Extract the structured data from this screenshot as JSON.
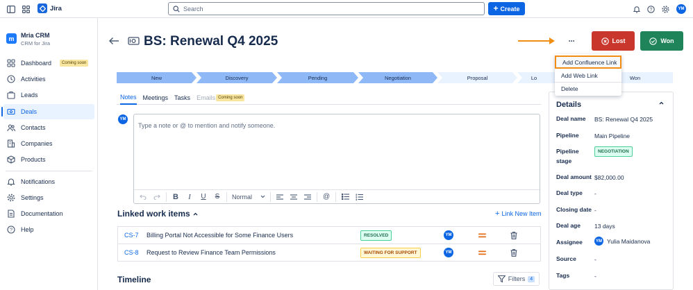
{
  "app": {
    "name": "Jira"
  },
  "search": {
    "placeholder": "Search"
  },
  "header": {
    "create_label": "Create",
    "avatar_initials": "YM"
  },
  "project": {
    "name": "Mria CRM",
    "subtitle": "CRM for Jira"
  },
  "sidebar": {
    "items": [
      {
        "label": "Dashboard",
        "badge": "Coming soon"
      },
      {
        "label": "Activities"
      },
      {
        "label": "Leads"
      },
      {
        "label": "Deals"
      },
      {
        "label": "Contacts"
      },
      {
        "label": "Companies"
      },
      {
        "label": "Products"
      },
      {
        "label": "Notifications"
      },
      {
        "label": "Settings"
      },
      {
        "label": "Documentation"
      },
      {
        "label": "Help"
      }
    ]
  },
  "deal": {
    "title": "BS: Renewal Q4 2025",
    "lost_label": "Lost",
    "won_label": "Won",
    "more_label": "···"
  },
  "pipeline": {
    "stages": [
      "New",
      "Discovery",
      "Pending",
      "Negotiation",
      "Proposal",
      "Lo",
      "Won"
    ],
    "current_index": 3
  },
  "menu": {
    "items": [
      "Add Confluence Link",
      "Add Web Link",
      "Delete"
    ]
  },
  "tabs": {
    "items": [
      "Notes",
      "Meetings",
      "Tasks",
      "Emails"
    ],
    "emails_badge": "Coming soon"
  },
  "note": {
    "placeholder": "Type a note or @ to mention and notify someone.",
    "avatar": "YM",
    "text_style": "Normal"
  },
  "linked": {
    "title": "Linked work items",
    "new_link_label": "Link New Item",
    "rows": [
      {
        "key": "CS-7",
        "summary": "Billing Portal Not Accessible for Some Finance Users",
        "status": "RESOLVED",
        "assignee": "YM"
      },
      {
        "key": "CS-8",
        "summary": "Request to Review Finance Team Permissions",
        "status": "WAITING FOR SUPPORT",
        "assignee": "YM"
      }
    ]
  },
  "timeline": {
    "title": "Timeline",
    "filters_label": "Filters",
    "filters_count": "4"
  },
  "details": {
    "title": "Details",
    "deal_name_label": "Deal name",
    "deal_name": "BS: Renewal Q4 2025",
    "pipeline_label": "Pipeline",
    "pipeline": "Main Pipeline",
    "stage_label_1": "Pipeline",
    "stage_label_2": "stage",
    "stage": "NEGOTIATION",
    "amount_label": "Deal amount",
    "amount": "$82,000.00",
    "type_label": "Deal type",
    "type": "-",
    "closing_label": "Closing date",
    "closing": "-",
    "age_label": "Deal age",
    "age": "13 days",
    "assignee_label": "Assignee",
    "assignee": "Yulia Maidanova",
    "assignee_initials": "YM",
    "source_label": "Source",
    "source": "-",
    "tags_label": "Tags",
    "tags": "-"
  },
  "colors": {
    "accent": "#0c66e4",
    "lost": "#c9372c",
    "won": "#1f845a",
    "highlight": "#f18d13",
    "stage_done": "#8fb8f6",
    "stage_todo": "#e9f2ff"
  }
}
